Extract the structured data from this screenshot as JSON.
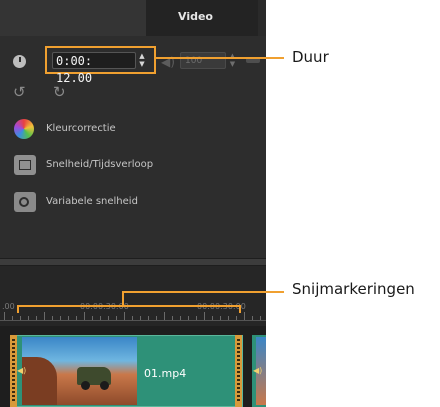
{
  "panel": {
    "tab_title": "Video",
    "timecode": "0:00: 12.00",
    "volume": "100",
    "tools": [
      {
        "label": "Kleurcorrectie",
        "icon": "color-wheel-icon"
      },
      {
        "label": "Snelheid/Tijdsverloop",
        "icon": "speed-icon"
      },
      {
        "label": "Variabele snelheid",
        "icon": "variable-speed-icon"
      }
    ],
    "icons": {
      "duration": "clock-icon",
      "volume": "speaker-icon",
      "rotate_left": "rotate-left-icon",
      "rotate_right": "rotate-right-icon"
    }
  },
  "timeline": {
    "ruler_labels": [
      ".00",
      "00:00:30:00",
      "00:00:30:00"
    ],
    "clip_name": "01.mp4"
  },
  "callouts": {
    "duration": "Duur",
    "trim_markers": "Snijmarkeringen"
  },
  "colors": {
    "highlight": "#f0a030",
    "clip": "#2e9178",
    "panel": "#2d2d2d"
  }
}
